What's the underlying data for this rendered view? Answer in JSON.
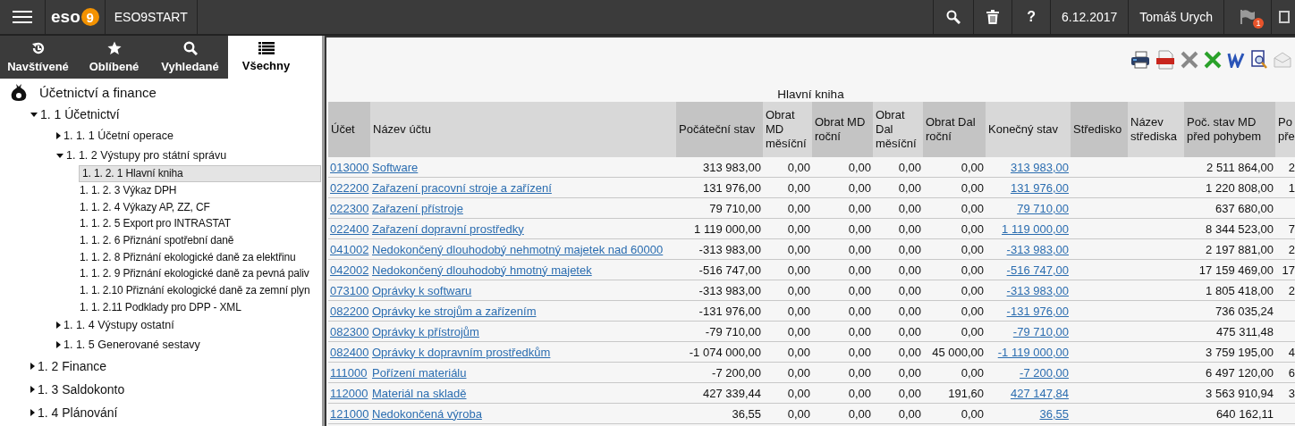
{
  "top_bar": {
    "logo_text": "eso",
    "logo_badge": "9",
    "app_name": "ESO9START",
    "help": "?",
    "date": "6.12.2017",
    "user": "Tomáš Urych",
    "notification_count": "1"
  },
  "sidebar": {
    "tabs": [
      {
        "label": "Navštívené",
        "selected": false
      },
      {
        "label": "Oblíbené",
        "selected": false
      },
      {
        "label": "Vyhledané",
        "selected": false
      },
      {
        "label": "Všechny",
        "selected": true
      }
    ],
    "tree": {
      "label": "Účetnictví a finance",
      "children": [
        {
          "label": "1. 1 Účetnictví",
          "kind": "branch",
          "expanded": true,
          "selected": false,
          "children": [
            {
              "label": "1. 1. 1 Účetní operace",
              "kind": "branch",
              "expanded": false,
              "selected": false
            },
            {
              "label": "1. 1. 2 Výstupy pro státní správu",
              "kind": "branch",
              "expanded": true,
              "selected": false,
              "children": [
                {
                  "label": "1. 1. 2. 1 Hlavní kniha",
                  "kind": "leaf",
                  "selected": true
                },
                {
                  "label": "1. 1. 2. 3 Výkaz DPH",
                  "kind": "leaf",
                  "selected": false
                },
                {
                  "label": "1. 1. 2. 4 Výkazy AP, ZZ, CF",
                  "kind": "leaf",
                  "selected": false
                },
                {
                  "label": "1. 1. 2. 5 Export pro INTRASTAT",
                  "kind": "leaf",
                  "selected": false
                },
                {
                  "label": "1. 1. 2. 6 Přiznání spotřební daně",
                  "kind": "leaf",
                  "selected": false
                },
                {
                  "label": "1. 1. 2. 8 Přiznání ekologické daně za elektřinu",
                  "kind": "leaf",
                  "selected": false
                },
                {
                  "label": "1. 1. 2. 9 Přiznání ekologické daně za pevná paliv",
                  "kind": "leaf",
                  "selected": false
                },
                {
                  "label": "1. 1. 2.10 Přiznání ekologické daně za zemní plyn",
                  "kind": "leaf",
                  "selected": false
                },
                {
                  "label": "1. 1. 2.11 Podklady pro DPP - XML",
                  "kind": "leaf",
                  "selected": false
                }
              ]
            },
            {
              "label": "1. 1. 4 Výstupy ostatní",
              "kind": "branch",
              "expanded": false,
              "selected": false
            },
            {
              "label": "1. 1. 5 Generované sestavy",
              "kind": "branch",
              "expanded": false,
              "selected": false
            }
          ]
        },
        {
          "label": "1. 2 Finance",
          "kind": "branch",
          "expanded": false,
          "selected": false
        },
        {
          "label": "1. 3 Saldokonto",
          "kind": "branch",
          "expanded": false,
          "selected": false
        },
        {
          "label": "1. 4 Plánování",
          "kind": "branch",
          "expanded": false,
          "selected": false
        }
      ]
    }
  },
  "report": {
    "title": "Hlavní kniha",
    "table": {
      "columns": [
        "Účet",
        "Název účtu",
        "Počáteční stav",
        "Obrat MD měsíční",
        "Obrat MD roční",
        "Obrat Dal měsíční",
        "Obrat Dal roční",
        "Konečný stav",
        "Středisko",
        "Název střediska",
        "Poč. stav MD před pohybem",
        "Po pře"
      ],
      "rows": [
        {
          "ucet": "013000",
          "nazev": "Software",
          "pocatecni": "313 983,00",
          "md_mes": "0,00",
          "md_roc": "0,00",
          "dal_mes": "0,00",
          "dal_roc": "0,00",
          "konecny": "313 983,00",
          "poc_md": "2 511 864,00",
          "column_12": "2"
        },
        {
          "ucet": "022200",
          "nazev": "Zařazení pracovní stroje a zařízení",
          "pocatecni": "131 976,00",
          "md_mes": "0,00",
          "md_roc": "0,00",
          "dal_mes": "0,00",
          "dal_roc": "0,00",
          "konecny": "131 976,00",
          "poc_md": "1 220 808,00",
          "column_12": "1"
        },
        {
          "ucet": "022300",
          "nazev": "Zařazení přístroje",
          "pocatecni": "79 710,00",
          "md_mes": "0,00",
          "md_roc": "0,00",
          "dal_mes": "0,00",
          "dal_roc": "0,00",
          "konecny": "79 710,00",
          "poc_md": "637 680,00"
        },
        {
          "ucet": "022400",
          "nazev": "Zařazení dopravní prostředky",
          "pocatecni": "1 119 000,00",
          "md_mes": "0,00",
          "md_roc": "0,00",
          "dal_mes": "0,00",
          "dal_roc": "0,00",
          "konecny": "1 119 000,00",
          "poc_md": "8 344 523,00",
          "column_12": "7"
        },
        {
          "ucet": "041002",
          "nazev": "Nedokončený dlouhodobý nehmotný majetek nad 60000",
          "pocatecni": "-313 983,00",
          "md_mes": "0,00",
          "md_roc": "0,00",
          "dal_mes": "0,00",
          "dal_roc": "0,00",
          "konecny": "-313 983,00",
          "poc_md": "2 197 881,00",
          "column_12": "2"
        },
        {
          "ucet": "042002",
          "nazev": "Nedokončený dlouhodobý hmotný majetek",
          "pocatecni": "-516 747,00",
          "md_mes": "0,00",
          "md_roc": "0,00",
          "dal_mes": "0,00",
          "dal_roc": "0,00",
          "konecny": "-516 747,00",
          "poc_md": "17 159 469,00",
          "column_12": "17"
        },
        {
          "ucet": "073100",
          "nazev": "Oprávky k softwaru",
          "pocatecni": "-313 983,00",
          "md_mes": "0,00",
          "md_roc": "0,00",
          "dal_mes": "0,00",
          "dal_roc": "0,00",
          "konecny": "-313 983,00",
          "poc_md": "1 805 418,00",
          "column_12": "2"
        },
        {
          "ucet": "082200",
          "nazev": "Oprávky ke strojům a zařízením",
          "pocatecni": "-131 976,00",
          "md_mes": "0,00",
          "md_roc": "0,00",
          "dal_mes": "0,00",
          "dal_roc": "0,00",
          "konecny": "-131 976,00",
          "poc_md": "736 035,24"
        },
        {
          "ucet": "082300",
          "nazev": "Oprávky k přístrojům",
          "pocatecni": "-79 710,00",
          "md_mes": "0,00",
          "md_roc": "0,00",
          "dal_mes": "0,00",
          "dal_roc": "0,00",
          "konecny": "-79 710,00",
          "poc_md": "475 311,48"
        },
        {
          "ucet": "082400",
          "nazev": "Oprávky k dopravním prostředkům",
          "pocatecni": "-1 074 000,00",
          "md_mes": "0,00",
          "md_roc": "0,00",
          "dal_mes": "0,00",
          "dal_roc": "45 000,00",
          "konecny": "-1 119 000,00",
          "poc_md": "3 759 195,00",
          "column_12": "4"
        },
        {
          "ucet": "111000",
          "nazev": "Pořízení materiálu",
          "pocatecni": "-7 200,00",
          "md_mes": "0,00",
          "md_roc": "0,00",
          "dal_mes": "0,00",
          "dal_roc": "0,00",
          "konecny": "-7 200,00",
          "poc_md": "6 497 120,00",
          "column_12": "6"
        },
        {
          "ucet": "112000",
          "nazev": "Materiál na skladě",
          "pocatecni": "427 339,44",
          "md_mes": "0,00",
          "md_roc": "0,00",
          "dal_mes": "0,00",
          "dal_roc": "191,60",
          "konecny": "427 147,84",
          "poc_md": "3 563 910,94",
          "column_12": "3"
        },
        {
          "ucet": "121000",
          "nazev": "Nedokončená výroba",
          "pocatecni": "36,55",
          "md_mes": "0,00",
          "md_roc": "0,00",
          "dal_mes": "0,00",
          "dal_roc": "0,00",
          "konecny": "36,55",
          "poc_md": "640 162,11"
        }
      ]
    }
  }
}
